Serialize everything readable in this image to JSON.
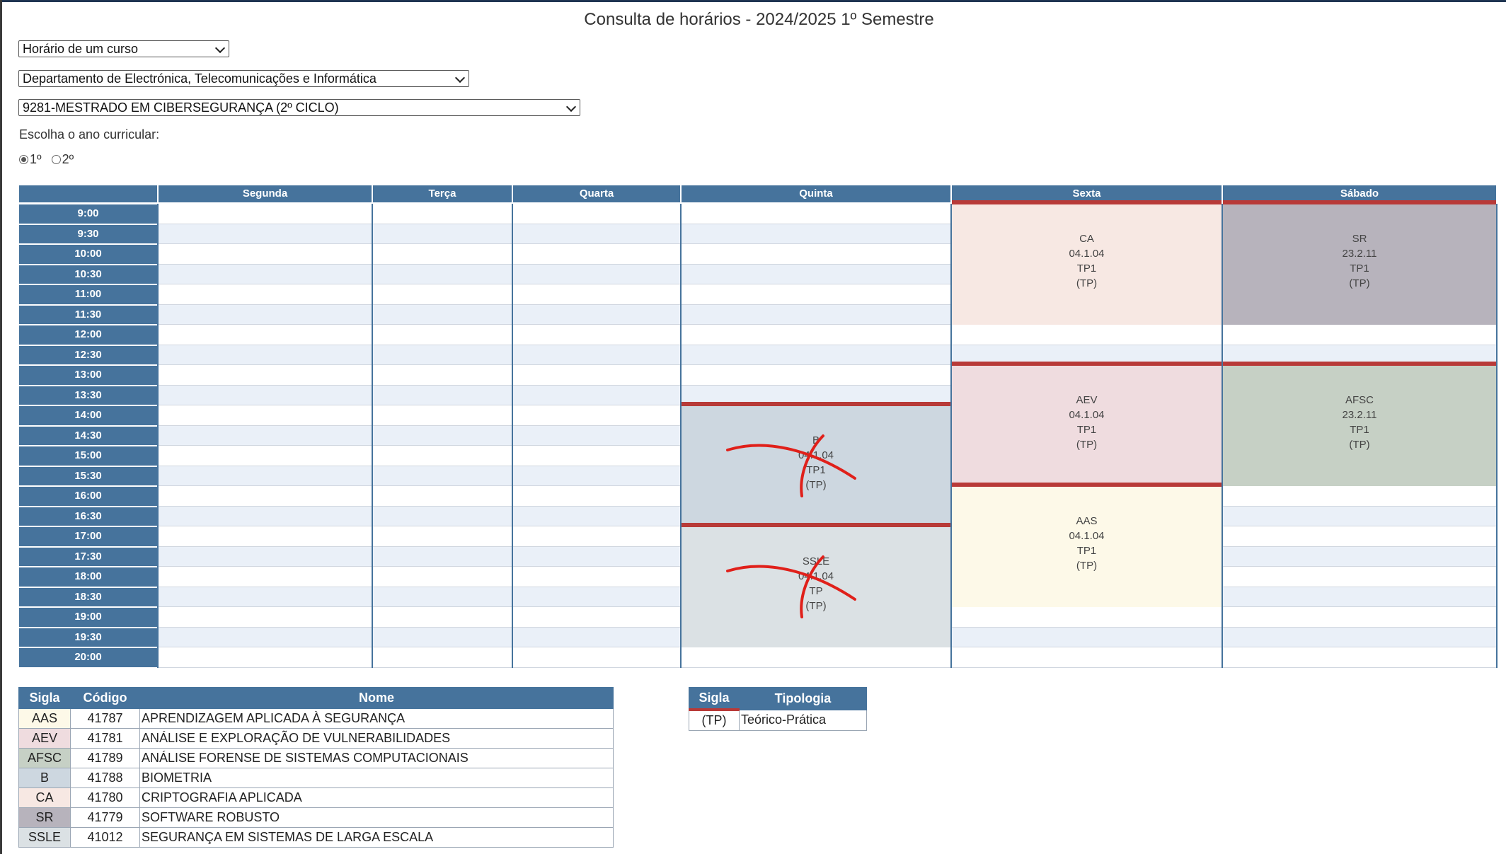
{
  "title": "Consulta de horários - 2024/2025 1º Semestre",
  "selects": {
    "tipo": "Horário de um curso",
    "departamento": "Departamento de Electrónica, Telecomunicações e Informática",
    "curso": "9281-MESTRADO EM CIBERSEGURANÇA (2º CICLO)"
  },
  "ano": {
    "label": "Escolha o ano curricular:",
    "options": [
      "1º",
      "2º"
    ],
    "selected": "1º"
  },
  "schedule": {
    "days": [
      "Segunda",
      "Terça",
      "Quarta",
      "Quinta",
      "Sexta",
      "Sábado"
    ],
    "times": [
      "9:00",
      "9:30",
      "10:00",
      "10:30",
      "11:00",
      "11:30",
      "12:00",
      "12:30",
      "13:00",
      "13:30",
      "14:00",
      "14:30",
      "15:00",
      "15:30",
      "16:00",
      "16:30",
      "17:00",
      "17:30",
      "18:00",
      "18:30",
      "19:00",
      "19:30",
      "20:00"
    ],
    "classes": [
      {
        "sigla": "CA",
        "sala": "04.1.04",
        "turno": "TP1",
        "tipo": "(TP)",
        "dia": "Sexta",
        "inicio": "9:00",
        "fim": "12:00",
        "color": "#f7e8e3",
        "crossed": false
      },
      {
        "sigla": "SR",
        "sala": "23.2.11",
        "turno": "TP1",
        "tipo": "(TP)",
        "dia": "Sábado",
        "inicio": "9:00",
        "fim": "12:00",
        "color": "#b7b3bc",
        "crossed": false
      },
      {
        "sigla": "AEV",
        "sala": "04.1.04",
        "turno": "TP1",
        "tipo": "(TP)",
        "dia": "Sexta",
        "inicio": "13:00",
        "fim": "16:00",
        "color": "#efdcdf",
        "crossed": false
      },
      {
        "sigla": "AFSC",
        "sala": "23.2.11",
        "turno": "TP1",
        "tipo": "(TP)",
        "dia": "Sábado",
        "inicio": "13:00",
        "fim": "16:00",
        "color": "#c6d0c5",
        "crossed": false
      },
      {
        "sigla": "B",
        "sala": "04.1.04",
        "turno": "TP1",
        "tipo": "(TP)",
        "dia": "Quinta",
        "inicio": "14:00",
        "fim": "17:00",
        "color": "#cdd7e0",
        "crossed": true
      },
      {
        "sigla": "SSLE",
        "sala": "04.1.04",
        "turno": "TP",
        "tipo": "(TP)",
        "dia": "Quinta",
        "inicio": "17:00",
        "fim": "20:00",
        "color": "#dbe1e4",
        "crossed": true
      },
      {
        "sigla": "AAS",
        "sala": "04.1.04",
        "turno": "TP1",
        "tipo": "(TP)",
        "dia": "Sexta",
        "inicio": "16:00",
        "fim": "19:00",
        "color": "#fdf9e8",
        "crossed": false
      }
    ]
  },
  "legend": {
    "headers": [
      "Sigla",
      "Código",
      "Nome"
    ],
    "rows": [
      {
        "sigla": "AAS",
        "codigo": "41787",
        "nome": "APRENDIZAGEM APLICADA À SEGURANÇA",
        "color": "#fdf9e8"
      },
      {
        "sigla": "AEV",
        "codigo": "41781",
        "nome": "ANÁLISE E EXPLORAÇÃO DE VULNERABILIDADES",
        "color": "#efdcdf"
      },
      {
        "sigla": "AFSC",
        "codigo": "41789",
        "nome": "ANÁLISE FORENSE DE SISTEMAS COMPUTACIONAIS",
        "color": "#c6d0c5"
      },
      {
        "sigla": "B",
        "codigo": "41788",
        "nome": "BIOMETRIA",
        "color": "#cdd7e0"
      },
      {
        "sigla": "CA",
        "codigo": "41780",
        "nome": "CRIPTOGRAFIA APLICADA",
        "color": "#f7e8e3"
      },
      {
        "sigla": "SR",
        "codigo": "41779",
        "nome": "SOFTWARE ROBUSTO",
        "color": "#b7b3bc"
      },
      {
        "sigla": "SSLE",
        "codigo": "41012",
        "nome": "SEGURANÇA EM SISTEMAS DE LARGA ESCALA",
        "color": "#dbe1e4"
      }
    ]
  },
  "tipologia": {
    "headers": [
      "Sigla",
      "Tipologia"
    ],
    "rows": [
      {
        "sigla": "(TP)",
        "nome": "Teórico-Prática"
      }
    ]
  },
  "colors": {
    "header": "#46739c",
    "block_border": "#b83a38",
    "alt_row": "#eaf0f8",
    "mark": "#e0201a"
  }
}
